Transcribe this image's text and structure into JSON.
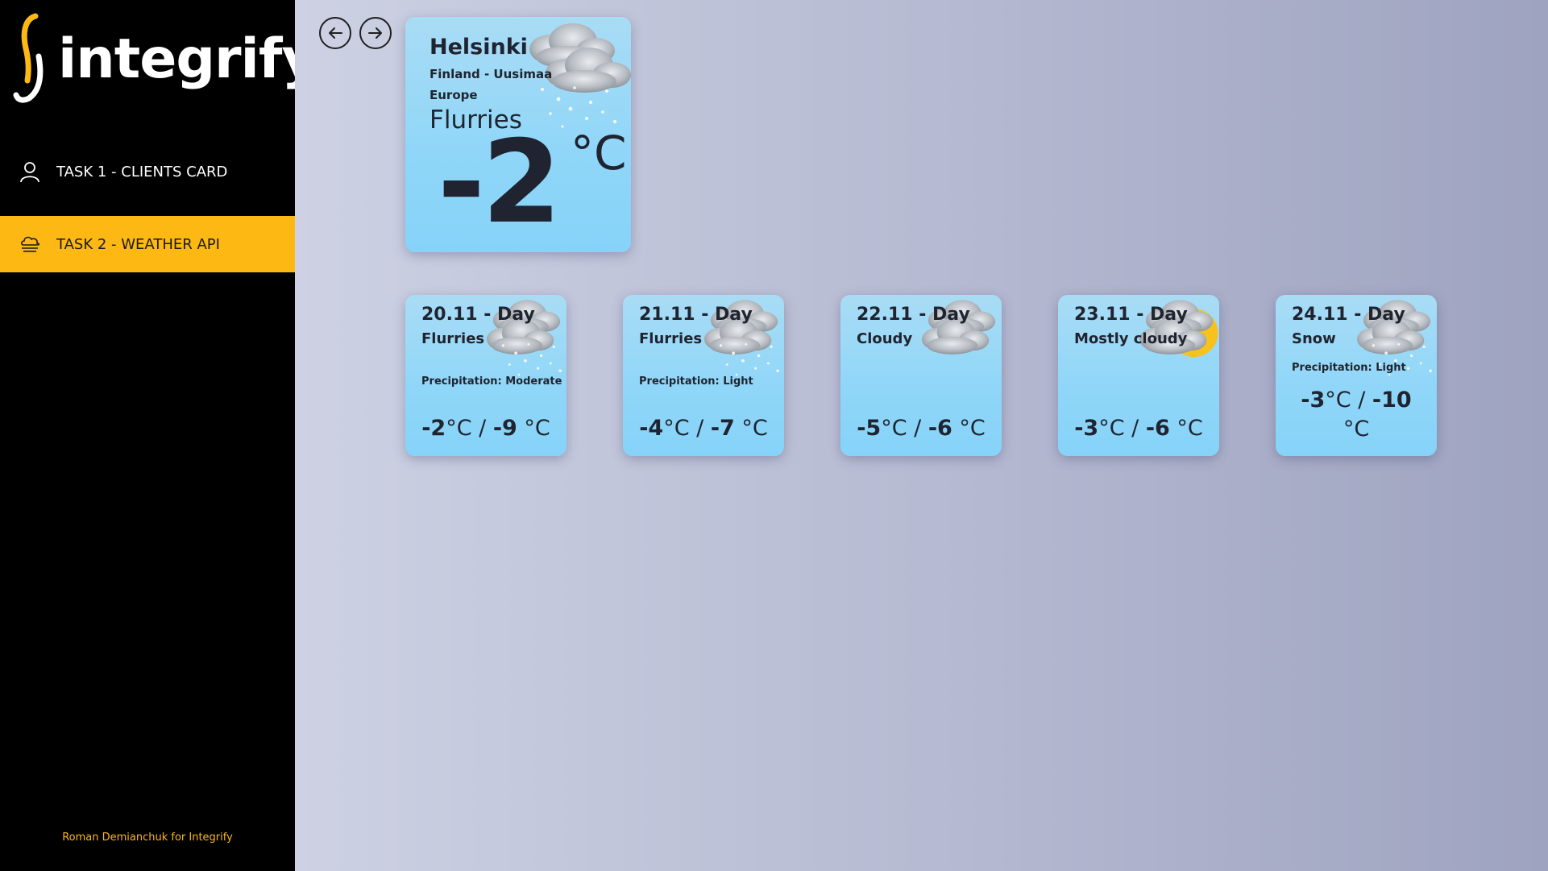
{
  "brand": {
    "name": "integrify",
    "accent": "#fdb813"
  },
  "nav": [
    {
      "label": "TASK 1 - CLIENTS CARD",
      "icon": "user-icon",
      "active": false
    },
    {
      "label": "TASK 2 - WEATHER API",
      "icon": "cloud-fog-icon",
      "active": true
    }
  ],
  "footer": {
    "credit": "Roman Demianchuk for Integrify"
  },
  "current": {
    "city": "Helsinki",
    "region": "Finland - Uusimaa",
    "continent": "Europe",
    "condition": "Flurries",
    "temperature": "-2",
    "unit": "°C",
    "icon": "flurries-icon"
  },
  "forecast": [
    {
      "date": "20.11 - Day",
      "condition": "Flurries",
      "precipitation": "Precipitation: Moderate",
      "max": "-2",
      "min": "-9",
      "unit": "°C",
      "icon": "flurries-icon"
    },
    {
      "date": "21.11 - Day",
      "condition": "Flurries",
      "precipitation": "Precipitation: Light",
      "max": "-4",
      "min": "-7",
      "unit": "°C",
      "icon": "flurries-icon"
    },
    {
      "date": "22.11 - Day",
      "condition": "Cloudy",
      "precipitation": "",
      "max": "-5",
      "min": "-6",
      "unit": "°C",
      "icon": "cloudy-icon"
    },
    {
      "date": "23.11 - Day",
      "condition": "Mostly cloudy",
      "precipitation": "",
      "max": "-3",
      "min": "-6",
      "unit": "°C",
      "icon": "mostly-cloudy-icon"
    },
    {
      "date": "24.11 - Day",
      "condition": "Snow",
      "precipitation": "Precipitation: Light",
      "max": "-3",
      "min": "-10",
      "unit": "°C",
      "icon": "snow-icon"
    }
  ]
}
